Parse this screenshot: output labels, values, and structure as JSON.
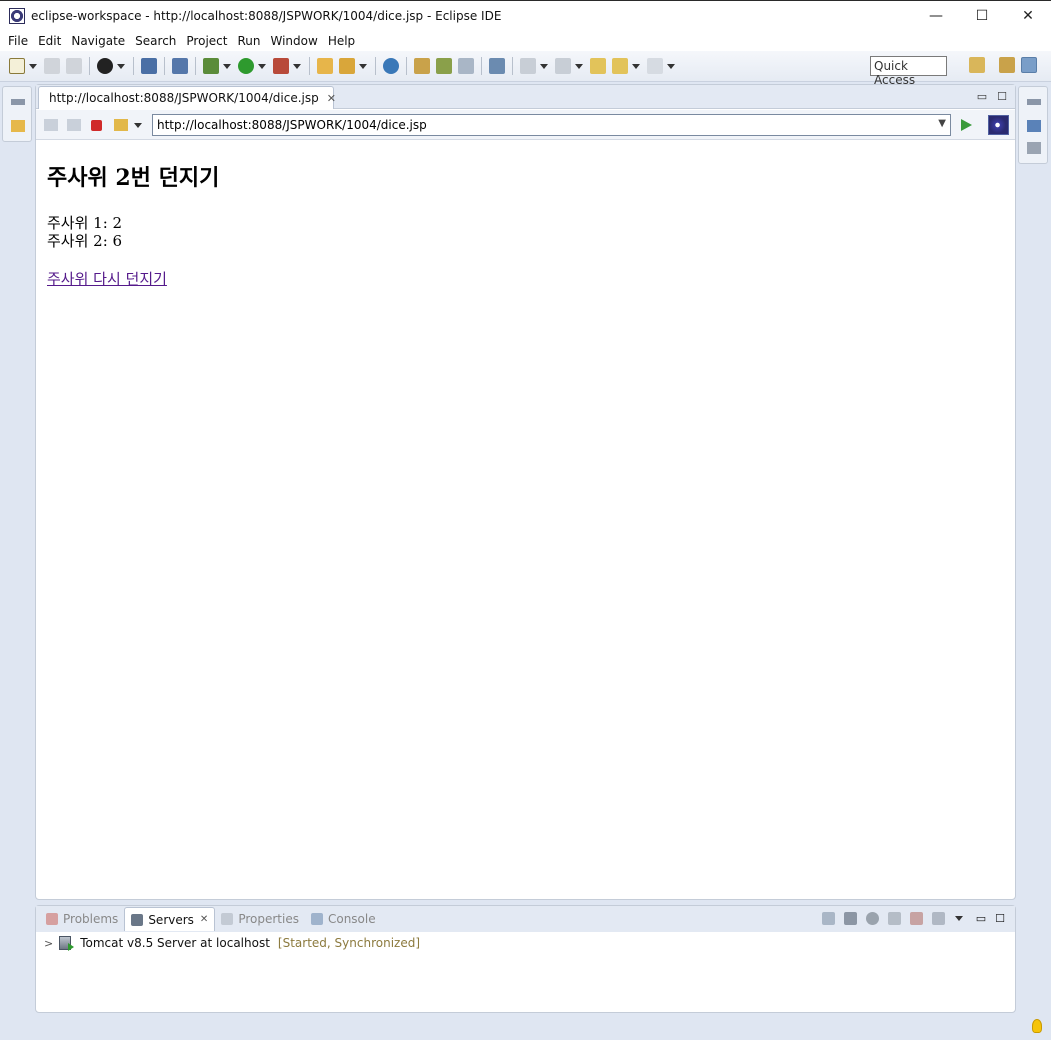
{
  "window": {
    "title": "eclipse-workspace - http://localhost:8088/JSPWORK/1004/dice.jsp - Eclipse IDE",
    "minimize": "—",
    "maximize": "☐",
    "close": "✕"
  },
  "menu": [
    "File",
    "Edit",
    "Navigate",
    "Search",
    "Project",
    "Run",
    "Window",
    "Help"
  ],
  "toolbar": {
    "quick_access": "Quick Access"
  },
  "editor": {
    "tab_title": "http://localhost:8088/JSPWORK/1004/dice.jsp",
    "tab_close": "✕",
    "url": "http://localhost:8088/JSPWORK/1004/dice.jsp",
    "minimize": "▭",
    "maximize": "☐"
  },
  "page": {
    "heading": "주사위 2번 던지기",
    "dice1": "주사위 1: 2",
    "dice2": "주사위 2: 6",
    "link": "주사위 다시 던지기"
  },
  "bottom_panel": {
    "tabs": [
      {
        "label": "Problems",
        "active": false
      },
      {
        "label": "Servers",
        "active": true
      },
      {
        "label": "Properties",
        "active": false
      },
      {
        "label": "Console",
        "active": false
      }
    ],
    "tab_close": "✕",
    "server": {
      "name": "Tomcat v8.5 Server at localhost",
      "status": "[Started, Synchronized]"
    }
  },
  "colors": {
    "link_visited": "#551a8b",
    "server_status": "#8c7a3e",
    "frame_bg": "#dfe6f2"
  }
}
